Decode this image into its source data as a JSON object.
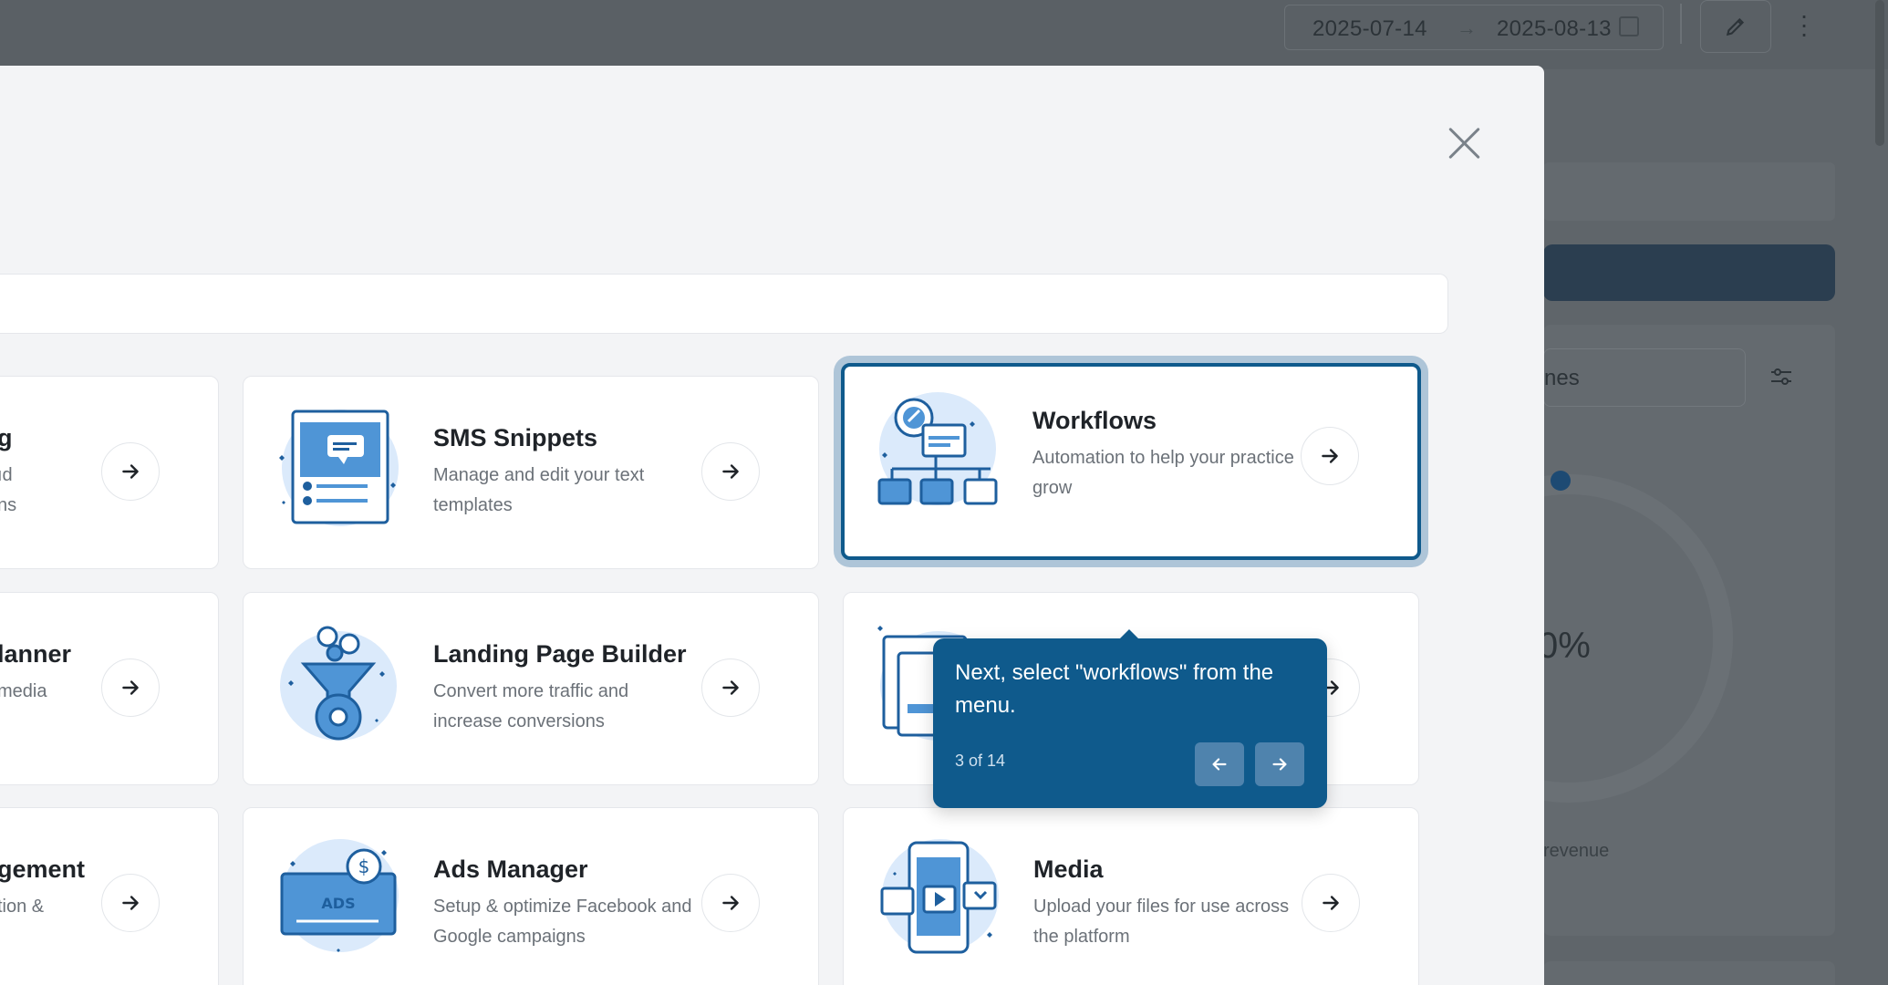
{
  "background": {
    "date_start": "2025-07-14",
    "date_end": "2025-08-13",
    "select_partial": "nes",
    "donut_partial": "0%",
    "revenue_partial": "revenue"
  },
  "cards": [
    {
      "title": "g",
      "desc": "ıd\nns"
    },
    {
      "title": "SMS Snippets",
      "desc": "Manage and edit your text templates"
    },
    {
      "title": "Workflows",
      "desc": "Automation to help your practice grow"
    },
    {
      "title": "lanner",
      "desc": "media"
    },
    {
      "title": "Landing Page Builder",
      "desc": "Convert more traffic and increase conversions"
    },
    {
      "title": "",
      "desc": ""
    },
    {
      "title": "gement",
      "desc": "tion &"
    },
    {
      "title": "Ads Manager",
      "desc": "Setup & optimize Facebook and Google campaigns"
    },
    {
      "title": "Media",
      "desc": "Upload your files for use across the platform"
    }
  ],
  "tour": {
    "message": "Next, select \"workflows\" from the menu.",
    "counter": "3 of 14"
  },
  "colors": {
    "accent": "#0f5a8c",
    "icon_blue": "#1e6fb5",
    "icon_light": "#dbeafb"
  }
}
